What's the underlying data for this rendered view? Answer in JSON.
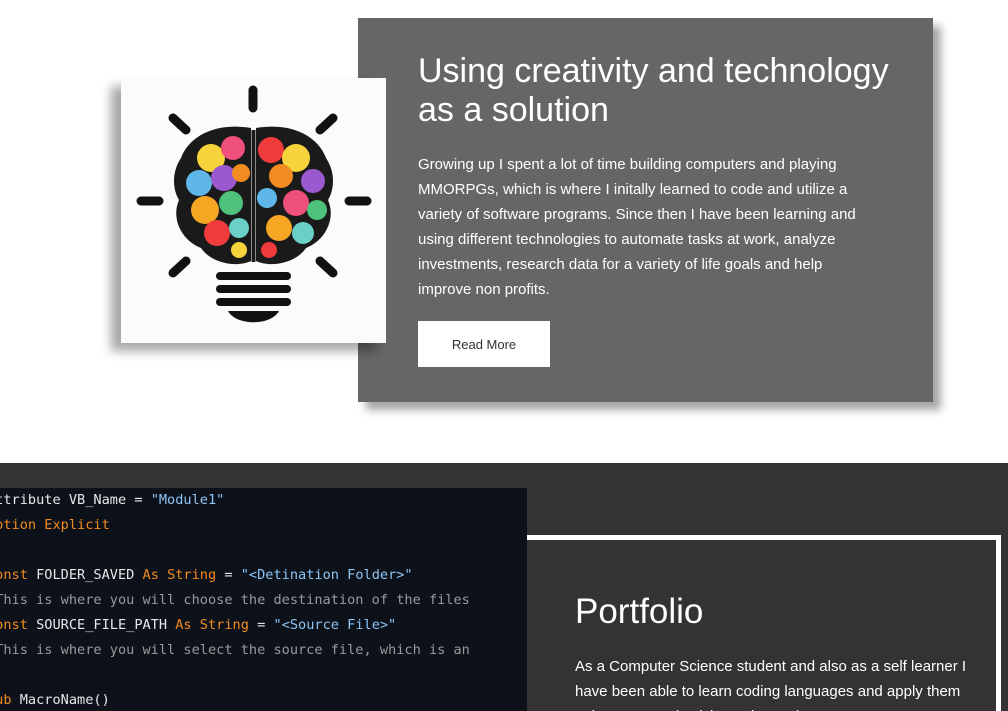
{
  "intro_card": {
    "title": "Using creativity and technology as a solution",
    "body": "Growing up I spent a lot of time building computers and playing MMORPGs, which is where I initally learned to code and utilize a variety of software programs. Since then I have been learning and using different technologies to automate tasks at work, analyze investments, research data for a variety of life goals and help improve non profits.",
    "button_label": "Read More",
    "image_icon": "lightbulb-brain-icon"
  },
  "code_snippet": {
    "lines": [
      [
        {
          "t": "Attribute VB_Name = ",
          "c": "pl"
        },
        {
          "t": "\"Module1\"",
          "c": "str"
        }
      ],
      [
        {
          "t": "Option Explicit",
          "c": "kw"
        }
      ],
      [],
      [
        {
          "t": "Const ",
          "c": "kw"
        },
        {
          "t": "FOLDER_SAVED ",
          "c": "pl"
        },
        {
          "t": "As String",
          "c": "kw"
        },
        {
          "t": " = ",
          "c": "pl"
        },
        {
          "t": "\"<Detination Folder>\"",
          "c": "str"
        }
      ],
      [
        {
          "t": "'This is where you will choose the destination of the files",
          "c": "cm"
        }
      ],
      [
        {
          "t": "Const ",
          "c": "kw"
        },
        {
          "t": "SOURCE_FILE_PATH ",
          "c": "pl"
        },
        {
          "t": "As String",
          "c": "kw"
        },
        {
          "t": " = ",
          "c": "pl"
        },
        {
          "t": "\"<Source File>\"",
          "c": "str"
        }
      ],
      [
        {
          "t": "'This is where you will select the source file, which is an",
          "c": "cm"
        }
      ],
      [],
      [
        {
          "t": "Sub ",
          "c": "kw"
        },
        {
          "t": "MacroName()",
          "c": "pl"
        }
      ]
    ]
  },
  "portfolio": {
    "title": "Portfolio",
    "body": "As a Computer Science student and also as a self learner I have been able to learn coding languages and apply them to improve productivity and to make"
  },
  "colors": {
    "card_gray": "#666666",
    "dark_section": "#333333",
    "code_background": "#0c111a",
    "code_keyword": "#f28b20",
    "code_string": "#8fc5f5"
  }
}
